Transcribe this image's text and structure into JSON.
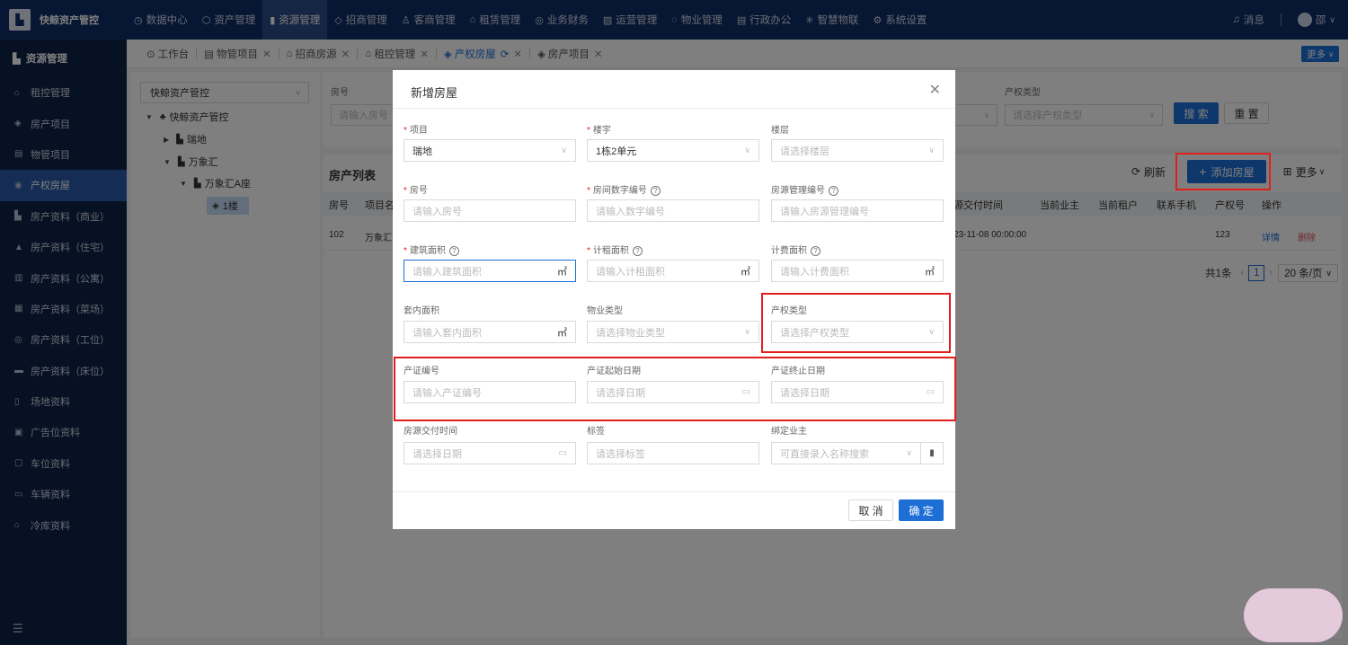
{
  "brand": {
    "name": "快鲸资产管控"
  },
  "topnav": [
    {
      "label": "数据中心",
      "icon": "◷"
    },
    {
      "label": "资产管理",
      "icon": "⬡"
    },
    {
      "label": "资源管理",
      "icon": "▮",
      "active": true
    },
    {
      "label": "招商管理",
      "icon": "◇"
    },
    {
      "label": "客商管理",
      "icon": "♙"
    },
    {
      "label": "租赁管理",
      "icon": "⌂"
    },
    {
      "label": "业务财务",
      "icon": "◎"
    },
    {
      "label": "运营管理",
      "icon": "▧"
    },
    {
      "label": "物业管理",
      "icon": "◌"
    },
    {
      "label": "行政办公",
      "icon": "▤"
    },
    {
      "label": "智慧物联",
      "icon": "✳"
    },
    {
      "label": "系统设置",
      "icon": "⚙"
    }
  ],
  "topright": {
    "messages": "消息",
    "user": "邵"
  },
  "sidebar": {
    "title": "资源管理",
    "items": [
      {
        "label": "租控管理",
        "icon": "⌂"
      },
      {
        "label": "房产项目",
        "icon": "◈"
      },
      {
        "label": "物管项目",
        "icon": "▤"
      },
      {
        "label": "产权房屋",
        "icon": "◉",
        "active": true
      },
      {
        "label": "房产资料（商业）",
        "icon": "▙"
      },
      {
        "label": "房产资料（住宅）",
        "icon": "▲"
      },
      {
        "label": "房产资料（公寓）",
        "icon": "▥"
      },
      {
        "label": "房产资料（菜场）",
        "icon": "▦"
      },
      {
        "label": "房产资料（工位）",
        "icon": "◎"
      },
      {
        "label": "房产资料（床位）",
        "icon": "▬"
      },
      {
        "label": "场地资料",
        "icon": "▯"
      },
      {
        "label": "广告位资料",
        "icon": "▣"
      },
      {
        "label": "车位资料",
        "icon": "▢"
      },
      {
        "label": "车辆资料",
        "icon": "▭"
      },
      {
        "label": "冷库资料",
        "icon": "⌂"
      }
    ],
    "footer_icon": "☰"
  },
  "tabs": [
    {
      "label": "工作台",
      "icon": "⊙",
      "closable": false
    },
    {
      "label": "物管项目",
      "icon": "▤",
      "closable": true
    },
    {
      "label": "招商房源",
      "icon": "⌂",
      "closable": true
    },
    {
      "label": "租控管理",
      "icon": "⌂",
      "closable": true
    },
    {
      "label": "产权房屋",
      "icon": "◈",
      "closable": true,
      "active": true
    },
    {
      "label": "房产项目",
      "icon": "◈",
      "closable": true
    }
  ],
  "more_button": "更多",
  "tree": {
    "select_value": "快鲸资产管控",
    "root": "快鲸资产管控",
    "n1": "瑞地",
    "n2": "万象汇",
    "n3": "万象汇A座",
    "n4": "1楼"
  },
  "search": {
    "room_label": "房号",
    "room_placeholder": "请输入房号",
    "ptype_label": "产权类型",
    "ptype_placeholder": "请选择产权类型",
    "search_btn": "搜 索",
    "reset_btn": "重 置"
  },
  "list": {
    "title": "房产列表",
    "refresh": "刷新",
    "add": "添加房屋",
    "more": "更多",
    "headers": [
      "房号",
      "项目名",
      "房源交付时间",
      "当前业主",
      "当前租户",
      "联系手机",
      "产权号",
      "操作"
    ],
    "row": {
      "room": "102",
      "project": "万象汇",
      "delivery": "2023-11-08 00:00:00",
      "owner": "",
      "tenant": "",
      "phone": "",
      "cert": "123",
      "detail": "详情",
      "delete": "删除"
    },
    "pager": {
      "total": "共1条",
      "page": "1",
      "size": "20 条/页"
    }
  },
  "dialog": {
    "title": "新增房屋",
    "fields": {
      "project": {
        "label": "项目",
        "value": "瑞地"
      },
      "building": {
        "label": "楼宇",
        "value": "1栋2单元"
      },
      "floor": {
        "label": "楼层",
        "placeholder": "请选择楼层"
      },
      "room": {
        "label": "房号",
        "placeholder": "请输入房号"
      },
      "room_digit": {
        "label": "房间数字编号",
        "placeholder": "请输入数字编号"
      },
      "room_code": {
        "label": "房源管理编号",
        "placeholder": "请输入房源管理编号"
      },
      "build_area": {
        "label": "建筑面积",
        "placeholder": "请输入建筑面积",
        "unit": "㎡"
      },
      "rent_area": {
        "label": "计租面积",
        "placeholder": "请输入计租面积",
        "unit": "㎡"
      },
      "fee_area": {
        "label": "计费面积",
        "placeholder": "请输入计费面积",
        "unit": "㎡"
      },
      "inner_area": {
        "label": "套内面积",
        "placeholder": "请输入套内面积",
        "unit": "㎡"
      },
      "prop_type": {
        "label": "物业类型",
        "placeholder": "请选择物业类型"
      },
      "own_type": {
        "label": "产权类型",
        "placeholder": "请选择产权类型"
      },
      "cert_no": {
        "label": "产证编号",
        "placeholder": "请输入产证编号"
      },
      "cert_start": {
        "label": "产证起始日期",
        "placeholder": "请选择日期"
      },
      "cert_end": {
        "label": "产证终止日期",
        "placeholder": "请选择日期"
      },
      "delivery": {
        "label": "房源交付时间",
        "placeholder": "请选择日期"
      },
      "tags": {
        "label": "标签",
        "placeholder": "请选择标签"
      },
      "owner": {
        "label": "绑定业主",
        "placeholder": "可直接录入名称搜索"
      }
    },
    "cancel": "取 消",
    "confirm": "确 定"
  }
}
